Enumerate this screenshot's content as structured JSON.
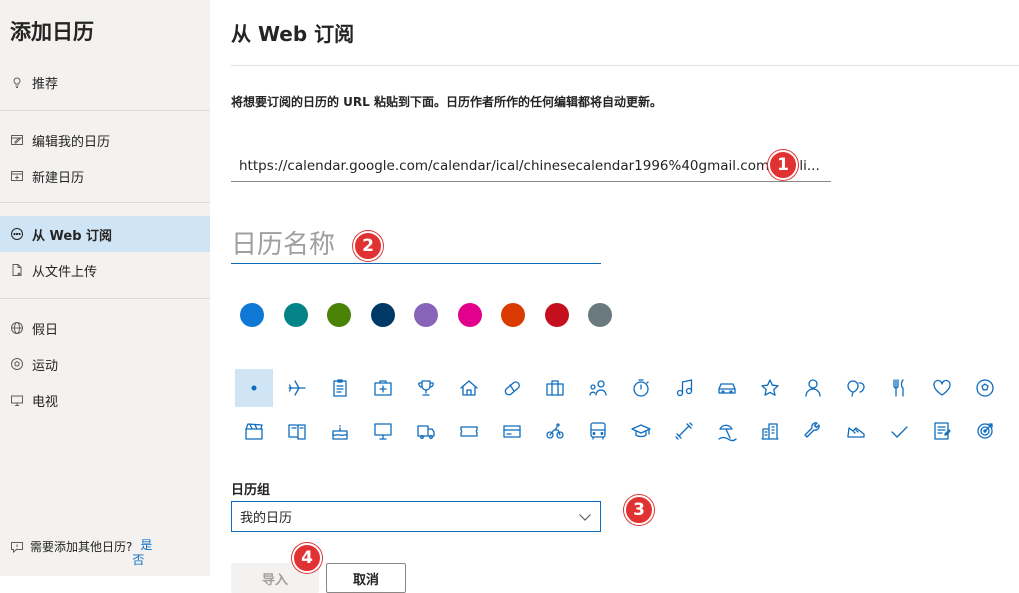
{
  "sidebar": {
    "title": "添加日历",
    "items": [
      {
        "label": "推荐",
        "icon": "lightbulb-icon"
      },
      {
        "label": "编辑我的日历",
        "icon": "edit-calendar-icon"
      },
      {
        "label": "新建日历",
        "icon": "new-calendar-icon"
      },
      {
        "label": "从 Web 订阅",
        "icon": "web-subscribe-icon"
      },
      {
        "label": "从文件上传",
        "icon": "file-upload-icon"
      },
      {
        "label": "假日",
        "icon": "globe-icon"
      },
      {
        "label": "运动",
        "icon": "sports-icon"
      },
      {
        "label": "电视",
        "icon": "tv-icon"
      }
    ],
    "help": {
      "text": "需要添加其他日历?",
      "yes": "是",
      "no": "否"
    }
  },
  "main": {
    "title": "从 Web 订阅",
    "instruction": "将想要订阅的日历的 URL 粘贴到下面。日历作者所作的任何编辑都将自动更新。",
    "url_value": "https://calendar.google.com/calendar/ical/chinesecalendar1996%40gmail.com/publi...",
    "name_placeholder": "日历名称",
    "colors": [
      "#0f78d4",
      "#038387",
      "#498205",
      "#003966",
      "#8764b8",
      "#e3008c",
      "#da3b01",
      "#c50f1f",
      "#69797e"
    ],
    "icons_row1": [
      "dot-icon",
      "airplane-icon",
      "clipboard-icon",
      "medkit-icon",
      "trophy-icon",
      "home-icon",
      "pill-icon",
      "briefcase-icon",
      "people-icon",
      "stopwatch-icon",
      "music-icon",
      "car-icon",
      "star-icon",
      "person-icon",
      "balloon-icon",
      "fork-knife-icon",
      "heart-icon",
      "soccer-ball-icon"
    ],
    "icons_row2": [
      "clapperboard-icon",
      "book-icon",
      "cake-icon",
      "monitor-icon",
      "truck-icon",
      "ticket-icon",
      "credit-card-icon",
      "cyclist-icon",
      "bus-icon",
      "graduation-cap-icon",
      "dumbbell-icon",
      "beach-icon",
      "building-icon",
      "wrench-icon",
      "shoe-icon",
      "check-icon",
      "notepad-icon",
      "target-icon"
    ],
    "group_label": "日历组",
    "group_value": "我的日历",
    "import_label": "导入",
    "cancel_label": "取消",
    "badges": [
      "1",
      "2",
      "3",
      "4"
    ]
  }
}
